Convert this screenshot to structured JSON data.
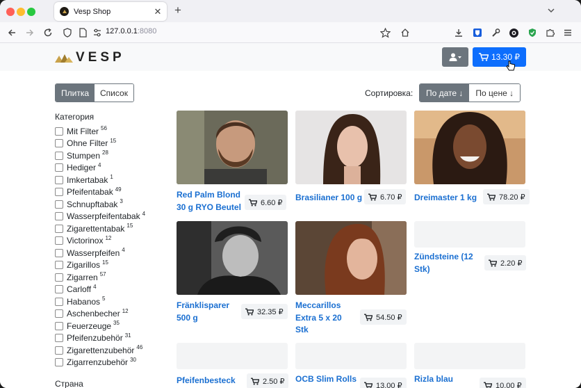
{
  "browser": {
    "tab_title": "Vesp Shop",
    "url_host": "127.0.0.1",
    "url_port": ":8080"
  },
  "header": {
    "logo_text": "VESP",
    "cart_total": "13.30 ₽"
  },
  "view_toggle": {
    "tile": "Плитка",
    "list": "Список"
  },
  "sort": {
    "label": "Сортировка:",
    "by_date": "По дате ↓",
    "by_price": "По цене ↓"
  },
  "filters": {
    "category_title": "Категория",
    "categories": [
      {
        "name": "Mit Filter",
        "count": "56"
      },
      {
        "name": "Ohne Filter",
        "count": "15"
      },
      {
        "name": "Stumpen",
        "count": "28"
      },
      {
        "name": "Hediger",
        "count": "4"
      },
      {
        "name": "Imkertabak",
        "count": "1"
      },
      {
        "name": "Pfeifentabak",
        "count": "49"
      },
      {
        "name": "Schnupftabak",
        "count": "3"
      },
      {
        "name": "Wasserpfeifentabak",
        "count": "4"
      },
      {
        "name": "Zigarettentabak",
        "count": "15"
      },
      {
        "name": "Victorinox",
        "count": "12"
      },
      {
        "name": "Wasserpfeifen",
        "count": "4"
      },
      {
        "name": "Zigarillos",
        "count": "15"
      },
      {
        "name": "Zigarren",
        "count": "57"
      },
      {
        "name": "Carloff",
        "count": "4"
      },
      {
        "name": "Habanos",
        "count": "5"
      },
      {
        "name": "Aschenbecher",
        "count": "12"
      },
      {
        "name": "Feuerzeuge",
        "count": "35"
      },
      {
        "name": "Pfeifenzubehör",
        "count": "31"
      },
      {
        "name": "Zigarettenzubehör",
        "count": "46"
      },
      {
        "name": "Zigarrenzubehör",
        "count": "30"
      }
    ],
    "country_title": "Страна"
  },
  "products": [
    {
      "name_lines": [
        "Red Palm Blond",
        "30 g RYO Beutel"
      ],
      "price": "6.60 ₽"
    },
    {
      "name_lines": [
        "Brasilianer 100 g"
      ],
      "price": "6.70 ₽"
    },
    {
      "name_lines": [
        "Dreimaster 1 kg"
      ],
      "price": "78.20 ₽"
    },
    {
      "name_lines": [
        "Fränklisparer",
        "500 g"
      ],
      "price": "32.35 ₽"
    },
    {
      "name_lines": [
        "Meccarillos",
        "Extra 5 x 20",
        "Stk"
      ],
      "price": "54.50 ₽"
    },
    {
      "name_lines": [
        "Zündsteine (12",
        "Stk)"
      ],
      "price": "2.20 ₽"
    },
    {
      "name_lines": [
        "Pfeifenbesteck"
      ],
      "price": "2.50 ₽"
    },
    {
      "name_lines": [
        "OCB Slim Rolls"
      ],
      "price": "13.00 ₽"
    },
    {
      "name_lines": [
        "Rizla blau"
      ],
      "price": "10.00 ₽"
    }
  ]
}
